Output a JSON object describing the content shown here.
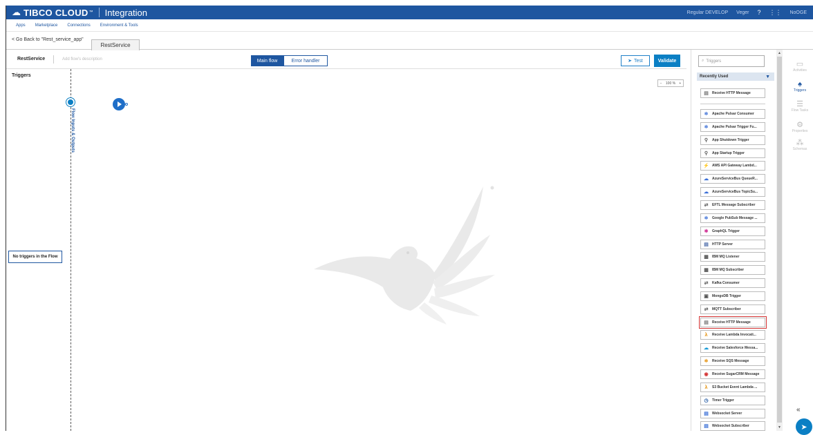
{
  "header": {
    "brand": "TIBCO CLOUD",
    "brand_tm": "™",
    "product": "Integration",
    "account": "Regular DEVELOP",
    "user": "Veger",
    "help_icon": "question-icon",
    "apps_icon": "grid-icon",
    "signout": "NoOGE"
  },
  "subnav": {
    "items": [
      "Apps",
      "Marketplace",
      "Connections",
      "Environment & Tools"
    ]
  },
  "tabs": {
    "go_back": "< Go Back to \"Rest_service_app\"",
    "flow_tab": "RestService"
  },
  "toolbar": {
    "flow_name": "RestService",
    "description_placeholder": "Add flow's description",
    "main_flow": "Main flow",
    "error_handler": "Error handler",
    "test": "Test",
    "validate": "Validate"
  },
  "canvas": {
    "triggers_title": "Triggers",
    "no_triggers": "No triggers in the Flow",
    "flow_io_label": "Flow Inputs & Outputs",
    "zoom": "100 %"
  },
  "palette": {
    "search_placeholder": "Triggers",
    "recent_label": "Recently Used",
    "recent_items": [
      "Receive HTTP Message"
    ],
    "items": [
      "Apache Pulsar Consumer",
      "Apache Pulsar Trigger Fu...",
      "App Shutdown Trigger",
      "App Startup Trigger",
      "AWS API Gateway Lambd...",
      "AzureServiceBus QueueR...",
      "AzureServiceBus TopicSu...",
      "EFTL Message Subscriber",
      "Google PubSub Message ...",
      "GraphQL Trigger",
      "HTTP Server",
      "IBM MQ Listener",
      "IBM MQ Subscriber",
      "Kafka Consumer",
      "MongoDB Trigger",
      "MQTT Subscriber",
      "Receive HTTP Message",
      "Receive Lambda Invocati...",
      "Receive Salesforce Messa...",
      "Receive SQS Message",
      "Receive SugarCRM Message",
      "S3 Bucket Event Lambda ...",
      "Timer Trigger",
      "Websocket Server",
      "Websocket Subscriber"
    ],
    "highlighted_item": "Receive HTTP Message"
  },
  "rail": {
    "items": [
      "Activities",
      "Triggers",
      "Flow Tasks",
      "Properties",
      "Schemas"
    ]
  },
  "colors": {
    "header": "#1e56a0",
    "accent": "#0b7fc4",
    "highlight": "#d43333"
  }
}
